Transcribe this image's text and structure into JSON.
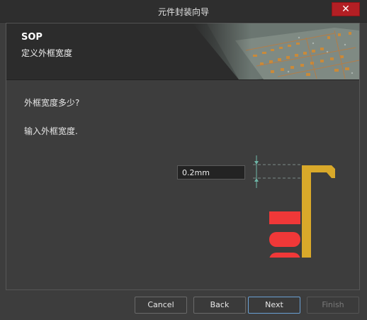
{
  "window": {
    "title": "元件封装向导",
    "close_glyph": "✕"
  },
  "header": {
    "title": "SOP",
    "subtitle": "定义外框宽度"
  },
  "body": {
    "question": "外框宽度多少?",
    "instruction": "输入外框宽度.",
    "outline_width_value": "0.2mm"
  },
  "buttons": {
    "cancel": "Cancel",
    "back": "Back",
    "next": "Next",
    "finish": "Finish"
  },
  "colors": {
    "pad": "#f03838",
    "outline": "#d9a92a",
    "dimension_line": "#6fb7a8",
    "close_button": "#b31f24"
  }
}
